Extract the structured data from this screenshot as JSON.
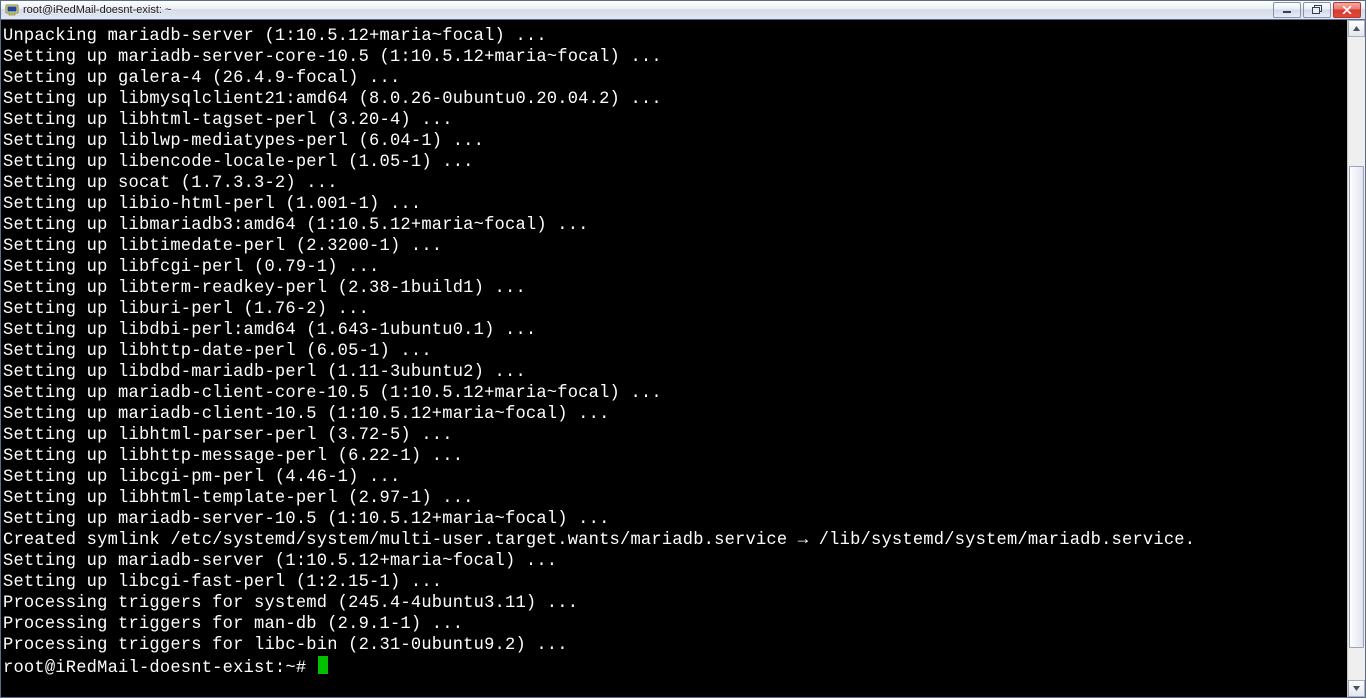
{
  "titlebar": {
    "title": "root@iRedMail-doesnt-exist: ~"
  },
  "prompt": "root@iRedMail-doesnt-exist:~# ",
  "lines": [
    "Unpacking mariadb-server (1:10.5.12+maria~focal) ...",
    "Setting up mariadb-server-core-10.5 (1:10.5.12+maria~focal) ...",
    "Setting up galera-4 (26.4.9-focal) ...",
    "Setting up libmysqlclient21:amd64 (8.0.26-0ubuntu0.20.04.2) ...",
    "Setting up libhtml-tagset-perl (3.20-4) ...",
    "Setting up liblwp-mediatypes-perl (6.04-1) ...",
    "Setting up libencode-locale-perl (1.05-1) ...",
    "Setting up socat (1.7.3.3-2) ...",
    "Setting up libio-html-perl (1.001-1) ...",
    "Setting up libmariadb3:amd64 (1:10.5.12+maria~focal) ...",
    "Setting up libtimedate-perl (2.3200-1) ...",
    "Setting up libfcgi-perl (0.79-1) ...",
    "Setting up libterm-readkey-perl (2.38-1build1) ...",
    "Setting up liburi-perl (1.76-2) ...",
    "Setting up libdbi-perl:amd64 (1.643-1ubuntu0.1) ...",
    "Setting up libhttp-date-perl (6.05-1) ...",
    "Setting up libdbd-mariadb-perl (1.11-3ubuntu2) ...",
    "Setting up mariadb-client-core-10.5 (1:10.5.12+maria~focal) ...",
    "Setting up mariadb-client-10.5 (1:10.5.12+maria~focal) ...",
    "Setting up libhtml-parser-perl (3.72-5) ...",
    "Setting up libhttp-message-perl (6.22-1) ...",
    "Setting up libcgi-pm-perl (4.46-1) ...",
    "Setting up libhtml-template-perl (2.97-1) ...",
    "Setting up mariadb-server-10.5 (1:10.5.12+maria~focal) ...",
    "Created symlink /etc/systemd/system/multi-user.target.wants/mariadb.service → /lib/systemd/system/mariadb.service.",
    "Setting up mariadb-server (1:10.5.12+maria~focal) ...",
    "Setting up libcgi-fast-perl (1:2.15-1) ...",
    "Processing triggers for systemd (245.4-4ubuntu3.11) ...",
    "Processing triggers for man-db (2.9.1-1) ...",
    "Processing triggers for libc-bin (2.31-0ubuntu9.2) ..."
  ]
}
